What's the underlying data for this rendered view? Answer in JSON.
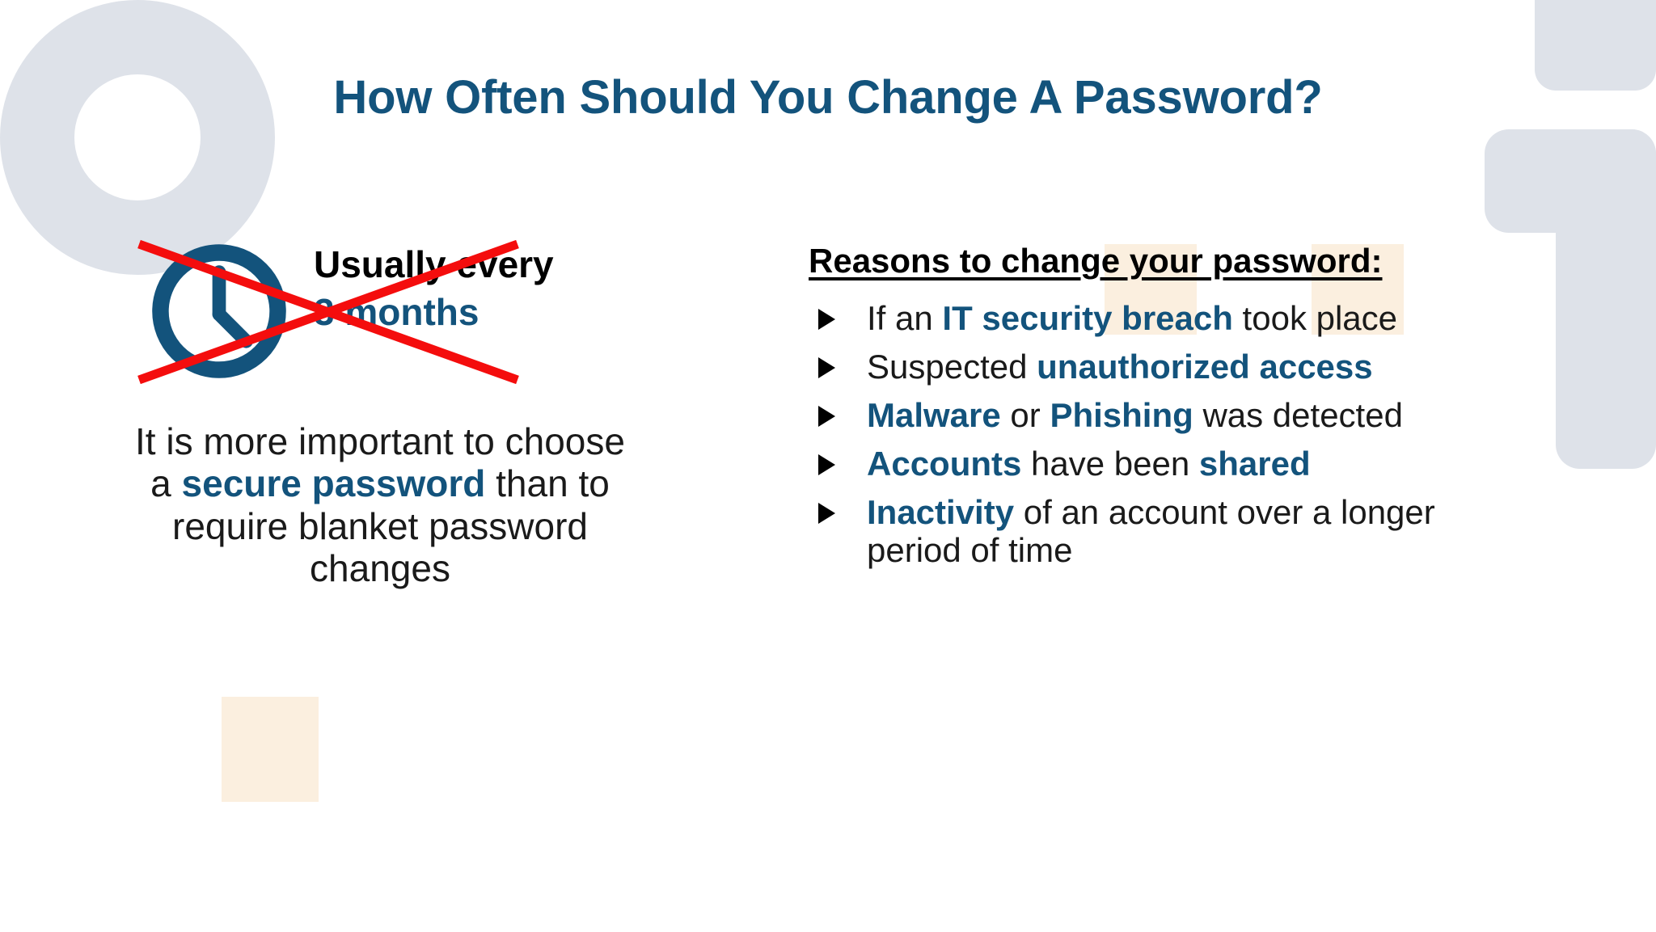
{
  "slide": {
    "title": "How Often Should You Change A Password?",
    "background_color": "#FFFFFF"
  },
  "colors": {
    "navy": "#13537C",
    "black": "#1A1A1A",
    "cross_out_red": "#F40D0D",
    "decor_gray_blue": "#DEE2E9",
    "highlight_cream": "#FBEFDF"
  },
  "left_column": {
    "clock_icon": "clock-icon",
    "cadence": {
      "line1": "Usually every",
      "line2": "3 months"
    },
    "crossed_out": true,
    "paragraph": {
      "part1": "It is more important to choose a ",
      "emphasis1": "secure password",
      "part2": " than to require blanket password changes"
    }
  },
  "right_column": {
    "heading": "Reasons to change your password:",
    "reasons": [
      {
        "segments": [
          {
            "text": "If an ",
            "emphasis": false
          },
          {
            "text": "IT security breach",
            "emphasis": true
          },
          {
            "text": " took place",
            "emphasis": false
          }
        ]
      },
      {
        "segments": [
          {
            "text": "Suspected ",
            "emphasis": false
          },
          {
            "text": "unauthorized access",
            "emphasis": true
          }
        ]
      },
      {
        "segments": [
          {
            "text": "Malware",
            "emphasis": true
          },
          {
            "text": " or ",
            "emphasis": false
          },
          {
            "text": "Phishing",
            "emphasis": true
          },
          {
            "text": " was detected",
            "emphasis": false
          }
        ]
      },
      {
        "segments": [
          {
            "text": "Accounts",
            "emphasis": true
          },
          {
            "text": " have been ",
            "emphasis": false
          },
          {
            "text": "shared",
            "emphasis": true
          }
        ]
      },
      {
        "segments": [
          {
            "text": "Inactivity",
            "emphasis": true
          },
          {
            "text": " of an account over a longer period of time",
            "emphasis": false
          }
        ]
      }
    ]
  }
}
